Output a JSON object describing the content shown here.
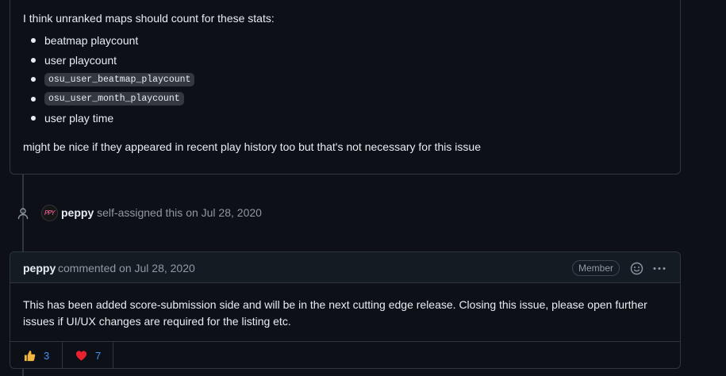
{
  "comment1": {
    "intro": "I think unranked maps should count for these stats:",
    "items": [
      {
        "text": "beatmap playcount",
        "code": false
      },
      {
        "text": "user playcount",
        "code": false
      },
      {
        "text": "osu_user_beatmap_playcount",
        "code": true
      },
      {
        "text": "osu_user_month_playcount",
        "code": true
      },
      {
        "text": "user play time",
        "code": false
      }
    ],
    "outro": "might be nice if they appeared in recent play history too but that's not necessary for this issue"
  },
  "event": {
    "icon": "person-icon",
    "avatar_text": "PPY",
    "user": "peppy",
    "action": "self-assigned this",
    "date": "on Jul 28, 2020"
  },
  "comment2": {
    "author": "peppy",
    "meta": "commented on Jul 28, 2020",
    "badge": "Member",
    "body": "This has been added score-submission side and will be in the next cutting edge release. Closing this issue, please open further issues if UI/UX changes are required for the listing etc.",
    "reactions": [
      {
        "icon": "thumbs-up-icon",
        "count": "3"
      },
      {
        "icon": "heart-icon",
        "count": "7"
      }
    ]
  },
  "colors": {
    "background": "#0d1117",
    "border": "#30363d",
    "link": "#4493f8",
    "muted": "#9198a1"
  }
}
